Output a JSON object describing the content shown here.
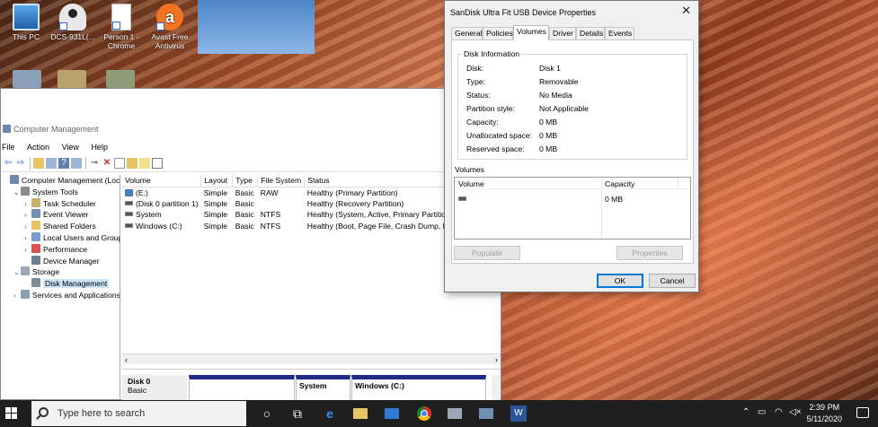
{
  "desktop": {
    "icons": [
      {
        "label": "This PC"
      },
      {
        "label": "DCS-931L(..."
      },
      {
        "label": "Person 1 - Chrome"
      },
      {
        "label": "Avast Free Antivirus"
      }
    ]
  },
  "computer_management": {
    "title": "Computer Management",
    "menu": [
      "File",
      "Action",
      "View",
      "Help"
    ],
    "tree": [
      {
        "label": "Computer Management (Local",
        "level": 0,
        "expand": "",
        "icon": "computer-icon"
      },
      {
        "label": "System Tools",
        "level": 1,
        "expand": "v",
        "icon": "tools-icon"
      },
      {
        "label": "Task Scheduler",
        "level": 2,
        "expand": ">",
        "icon": "clock-icon"
      },
      {
        "label": "Event Viewer",
        "level": 2,
        "expand": ">",
        "icon": "event-viewer-icon"
      },
      {
        "label": "Shared Folders",
        "level": 2,
        "expand": ">",
        "icon": "folder-icon"
      },
      {
        "label": "Local Users and Groups",
        "level": 2,
        "expand": ">",
        "icon": "users-icon"
      },
      {
        "label": "Performance",
        "level": 2,
        "expand": ">",
        "icon": "performance-icon"
      },
      {
        "label": "Device Manager",
        "level": 2,
        "expand": "",
        "icon": "device-manager-icon"
      },
      {
        "label": "Storage",
        "level": 1,
        "expand": "v",
        "icon": "storage-icon"
      },
      {
        "label": "Disk Management",
        "level": 2,
        "expand": "",
        "icon": "disk-icon",
        "selected": true
      },
      {
        "label": "Services and Applications",
        "level": 1,
        "expand": ">",
        "icon": "services-icon"
      }
    ],
    "columns": [
      "Volume",
      "Layout",
      "Type",
      "File System",
      "Status"
    ],
    "volumes": [
      {
        "volume": "(E:)",
        "layout": "Simple",
        "type": "Basic",
        "fs": "RAW",
        "status": "Healthy (Primary Partition)"
      },
      {
        "volume": "(Disk 0 partition 1)",
        "layout": "Simple",
        "type": "Basic",
        "fs": "",
        "status": "Healthy (Recovery Partition)"
      },
      {
        "volume": "System",
        "layout": "Simple",
        "type": "Basic",
        "fs": "NTFS",
        "status": "Healthy (System, Active, Primary Partition"
      },
      {
        "volume": "Windows (C:)",
        "layout": "Simple",
        "type": "Basic",
        "fs": "NTFS",
        "status": "Healthy (Boot, Page File, Crash Dump, Pri"
      }
    ],
    "disk_pane": {
      "disk_name": "Disk 0",
      "disk_type": "Basic",
      "partitions": [
        "System",
        "Windows (C:)"
      ]
    }
  },
  "dialog": {
    "title": "SanDisk Ultra Fit USB Device Properties",
    "tabs": [
      "General",
      "Policies",
      "Volumes",
      "Driver",
      "Details",
      "Events"
    ],
    "active_tab": "Volumes",
    "disk_info_title": "Disk Information",
    "disk_info": [
      {
        "key": "Disk:",
        "value": "Disk 1"
      },
      {
        "key": "Type:",
        "value": "Removable"
      },
      {
        "key": "Status:",
        "value": "No Media"
      },
      {
        "key": "Partition style:",
        "value": "Not Applicable"
      },
      {
        "key": "Capacity:",
        "value": "0 MB"
      },
      {
        "key": "Unallocated space:",
        "value": "0 MB"
      },
      {
        "key": "Reserved space:",
        "value": "0 MB"
      }
    ],
    "volumes_label": "Volumes",
    "volume_columns": [
      "Volume",
      "Capacity"
    ],
    "volume_rows": [
      {
        "volume": "",
        "capacity": "0 MB"
      }
    ],
    "populate_label": "Populate",
    "properties_label": "Properties",
    "ok_label": "OK",
    "cancel_label": "Cancel"
  },
  "taskbar": {
    "search_placeholder": "Type here to search",
    "time": "2:39 PM",
    "date": "5/11/2020"
  }
}
